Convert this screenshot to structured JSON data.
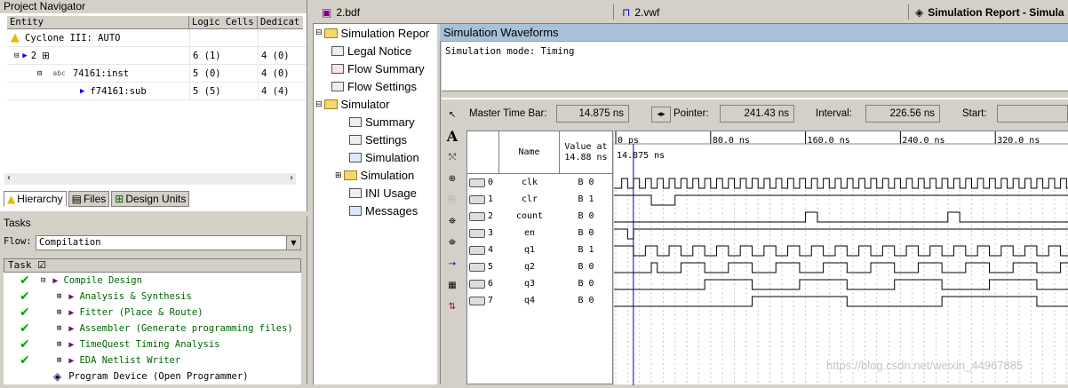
{
  "project_navigator": {
    "title": "Project Navigator",
    "columns": [
      "Entity",
      "Logic Cells",
      "Dedicat"
    ],
    "rows": [
      {
        "entity": "Cyclone III: AUTO",
        "cells": "",
        "dedicated": "",
        "level": 0
      },
      {
        "entity": "2",
        "cells": "6 (1)",
        "dedicated": "4 (0)",
        "level": 1
      },
      {
        "entity": "74161:inst",
        "cells": "5 (0)",
        "dedicated": "4 (0)",
        "level": 2
      },
      {
        "entity": "f74161:sub",
        "cells": "5 (5)",
        "dedicated": "4 (4)",
        "level": 3
      }
    ],
    "tabs": [
      "Hierarchy",
      "Files",
      "Design Units"
    ]
  },
  "tasks": {
    "title": "Tasks",
    "flow_label": "Flow:",
    "flow_value": "Compilation",
    "header": "Task",
    "items": [
      {
        "label": "Compile Design",
        "done": true,
        "indent": 0
      },
      {
        "label": "Analysis & Synthesis",
        "done": true,
        "indent": 1
      },
      {
        "label": "Fitter (Place & Route)",
        "done": true,
        "indent": 1
      },
      {
        "label": "Assembler (Generate programming files)",
        "done": true,
        "indent": 1
      },
      {
        "label": "TimeQuest Timing Analysis",
        "done": true,
        "indent": 1
      },
      {
        "label": "EDA Netlist Writer",
        "done": true,
        "indent": 1
      },
      {
        "label": "Program Device (Open Programmer)",
        "done": false,
        "indent": 0
      }
    ]
  },
  "doc_tabs": [
    "2.bdf",
    "2.vwf",
    "Simulation Report - Simula"
  ],
  "report_tree": [
    {
      "label": "Simulation Repor",
      "level": 0,
      "icon": "folder"
    },
    {
      "label": "Legal Notice",
      "level": 1,
      "icon": "doc"
    },
    {
      "label": "Flow Summary",
      "level": 1,
      "icon": "table"
    },
    {
      "label": "Flow Settings",
      "level": 1,
      "icon": "table"
    },
    {
      "label": "Simulator",
      "level": 0,
      "icon": "folder"
    },
    {
      "label": "Summary",
      "level": 2,
      "icon": "table"
    },
    {
      "label": "Settings",
      "level": 2,
      "icon": "table"
    },
    {
      "label": "Simulation",
      "level": 2,
      "icon": "wave"
    },
    {
      "label": "Simulation",
      "level": 2,
      "icon": "folder"
    },
    {
      "label": "INI Usage",
      "level": 2,
      "icon": "table"
    },
    {
      "label": "Messages",
      "level": 2,
      "icon": "info"
    }
  ],
  "waveform_panel": {
    "title": "Simulation Waveforms",
    "mode": "Simulation mode: Timing",
    "master_time_bar_label": "Master Time Bar:",
    "master_time_bar_value": "14.875 ns",
    "pointer_label": "Pointer:",
    "pointer_value": "241.43 ns",
    "interval_label": "Interval:",
    "interval_value": "226.56 ns",
    "start_label": "Start:",
    "start_value": "",
    "name_header": "Name",
    "value_header": "Value at\n14.88 ns",
    "time_ticks": [
      "0 ps",
      "80.0 ns",
      "160.0 ns",
      "240.0 ns",
      "320.0 ns"
    ],
    "cursor_label": "14.875 ns",
    "signals": [
      {
        "index": "0",
        "name": "clk",
        "value": "B 0",
        "dir": "in"
      },
      {
        "index": "1",
        "name": "clr",
        "value": "B 1",
        "dir": "in"
      },
      {
        "index": "2",
        "name": "count",
        "value": "B 0",
        "dir": "out"
      },
      {
        "index": "3",
        "name": "en",
        "value": "B 0",
        "dir": "in"
      },
      {
        "index": "4",
        "name": "q1",
        "value": "B 1",
        "dir": "out"
      },
      {
        "index": "5",
        "name": "q2",
        "value": "B 0",
        "dir": "out"
      },
      {
        "index": "6",
        "name": "q3",
        "value": "B 0",
        "dir": "out"
      },
      {
        "index": "7",
        "name": "q4",
        "value": "B 0",
        "dir": "out"
      }
    ]
  },
  "watermark": "https://blog.csdn.net/weixin_44967885"
}
